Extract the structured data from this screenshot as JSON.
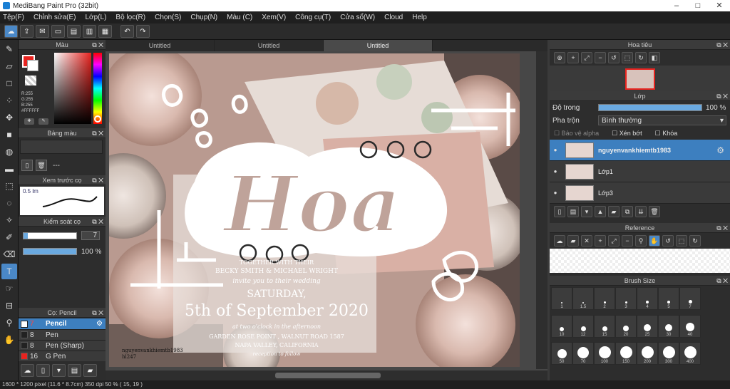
{
  "window": {
    "title": "MediBang Paint Pro (32bit)",
    "minimize": "–",
    "maximize": "□",
    "close": "✕"
  },
  "menu": [
    "Tệp(F)",
    "Chỉnh sửa(E)",
    "Lớp(L)",
    "Bộ lọc(R)",
    "Chọn(S)",
    "Chụp(N)",
    "Màu (C)",
    "Xem(V)",
    "Công cụ(T)",
    "Cửa sổ(W)",
    "Cloud",
    "Help"
  ],
  "tabs": [
    "Untitled",
    "Untitled",
    "Untitled"
  ],
  "color_panel": {
    "title": "Màu",
    "r": "R:255",
    "g": "G:255",
    "b": "B:255",
    "hex": "#FFFFFF",
    "primary_color": "#e8231f",
    "secondary_color": "#ffffff"
  },
  "palette_panel": {
    "title": "Bảng màu",
    "value": "---"
  },
  "brush_preview": {
    "title": "Xem trước cọ",
    "size_label": "0.5 lm"
  },
  "brush_control": {
    "title": "Kiểm soát cọ",
    "size_value": "7",
    "opacity_value": "100 %",
    "opacity_fraction": 1.0
  },
  "brush_list": {
    "title": "Cọ: Pencil",
    "items": [
      {
        "size": "7",
        "name": "Pencil",
        "color": "#ffffff",
        "selected": true
      },
      {
        "size": "8",
        "name": "Pen",
        "color": "#ffffff",
        "selected": false
      },
      {
        "size": "8",
        "name": "Pen (Sharp)",
        "color": "#ffffff",
        "selected": false
      },
      {
        "size": "16",
        "name": "G Pen",
        "color": "#e8231f",
        "selected": false
      }
    ]
  },
  "artwork": {
    "title_text": "Hoa",
    "card_lines": [
      "TOGETHER WITH THEIR",
      "BECKY SMITH & MICHAEL WRIGHT",
      "invite you to their wedding",
      "SATURDAY,",
      "5th of September 2020",
      "at two o'clock in the afternoon",
      "GARDEN ROSE POINT , WALNUT ROAD 1587",
      "NAPA VALLEY, CALIFORNIA",
      "reception to follow"
    ],
    "watermark": [
      "nguyenvankhiemtb1983",
      "hl247"
    ]
  },
  "navigator": {
    "title": "Hoa tiêu"
  },
  "layers": {
    "title": "Lớp",
    "opacity_label": "Độ trong",
    "opacity_value": "100 %",
    "opacity_fraction": 1.0,
    "blend_label": "Pha trộn",
    "blend_value": "Bình thường",
    "protect_alpha": "Bảo vệ alpha",
    "clipping": "Xén bớt",
    "lock": "Khóa",
    "items": [
      {
        "name": "nguyenvankhiemtb1983",
        "selected": true
      },
      {
        "name": "Lớp1",
        "selected": false
      },
      {
        "name": "Lớp3",
        "selected": false
      }
    ]
  },
  "reference": {
    "title": "Reference"
  },
  "brush_size": {
    "title": "Brush Size",
    "sizes": [
      "1",
      "1.5",
      "2",
      "3",
      "4",
      "5",
      "7",
      "10",
      "12",
      "15",
      "20",
      "25",
      "30",
      "40",
      "50",
      "70",
      "100",
      "150",
      "200",
      "300",
      "400"
    ]
  },
  "status": "1600 * 1200 pixel  (11.6 * 8.7cm)  350 dpi  50 %  ( 15, 19 )"
}
